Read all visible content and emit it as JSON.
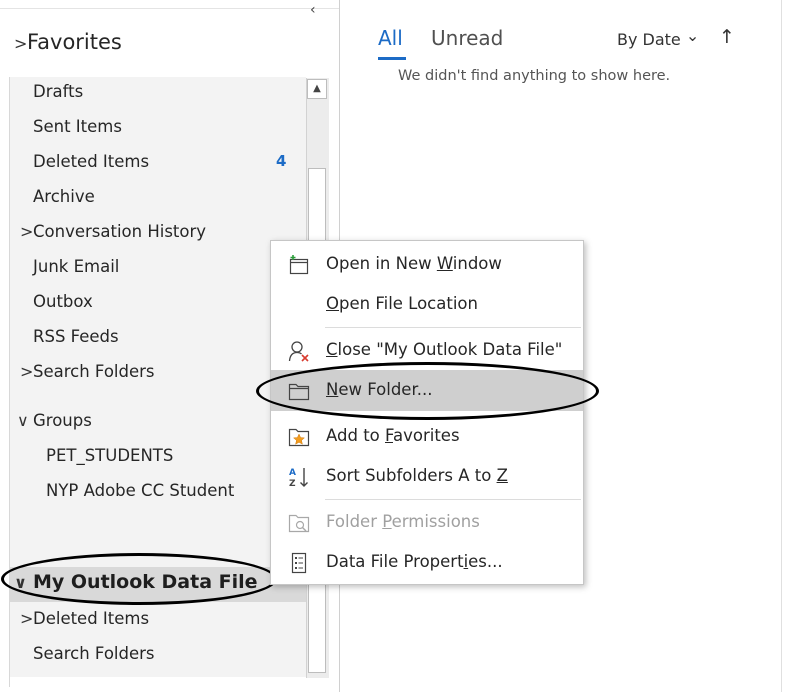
{
  "nav": {
    "collapse_icon": "‹",
    "favorites": {
      "chevron": ">",
      "label": "Favorites"
    },
    "items": [
      {
        "label": "Drafts"
      },
      {
        "label": "Sent Items"
      },
      {
        "label": "Deleted Items",
        "badge": "4"
      },
      {
        "label": "Archive"
      },
      {
        "label": "Conversation History",
        "chevron": ">"
      },
      {
        "label": "Junk Email"
      },
      {
        "label": "Outbox"
      },
      {
        "label": "RSS Feeds"
      },
      {
        "label": "Search Folders",
        "chevron": ">"
      }
    ],
    "groups": {
      "chevron": "∨",
      "label": "Groups",
      "items": [
        {
          "label": "PET_STUDENTS"
        },
        {
          "label": "NYP Adobe CC Student"
        }
      ]
    },
    "data_file": {
      "chevron": "∨",
      "label": "My Outlook Data File",
      "items": [
        {
          "label": "Deleted Items",
          "chevron": ">"
        },
        {
          "label": "Search Folders"
        }
      ]
    }
  },
  "main": {
    "tabs": [
      {
        "label": "All",
        "active": true
      },
      {
        "label": "Unread"
      }
    ],
    "sort_label": "By Date",
    "sort_chevron": "⌄",
    "sort_direction_icon": "↑",
    "empty_message": "We didn't find anything to show here."
  },
  "context_menu": {
    "items": [
      {
        "pre": "Open in New ",
        "key": "W",
        "post": "indow",
        "icon": "new-window-icon"
      },
      {
        "pre": "",
        "key": "O",
        "post": "pen File Location",
        "icon": ""
      },
      {
        "pre": "",
        "key": "C",
        "post": "lose \"My Outlook Data File\"",
        "icon": "close-person-icon"
      },
      {
        "pre": "",
        "key": "N",
        "post": "ew Folder...",
        "icon": "folder-icon",
        "highlighted": true
      },
      {
        "pre": "Add to ",
        "key": "F",
        "post": "avorites",
        "icon": "star-folder-icon"
      },
      {
        "pre": "Sort Subfolders A to ",
        "key": "Z",
        "post": "",
        "icon": "sort-az-icon"
      },
      {
        "pre": "Folder ",
        "key": "P",
        "post": "ermissions",
        "icon": "folder-permissions-icon",
        "disabled": true
      },
      {
        "pre": "Data File Propert",
        "key": "i",
        "post": "es...",
        "icon": "properties-icon"
      }
    ]
  },
  "colors": {
    "accent": "#1c6bc6",
    "selection": "#d9d9d9",
    "pane_bg": "#f3f3f3",
    "highlight_ring": "#000000"
  }
}
